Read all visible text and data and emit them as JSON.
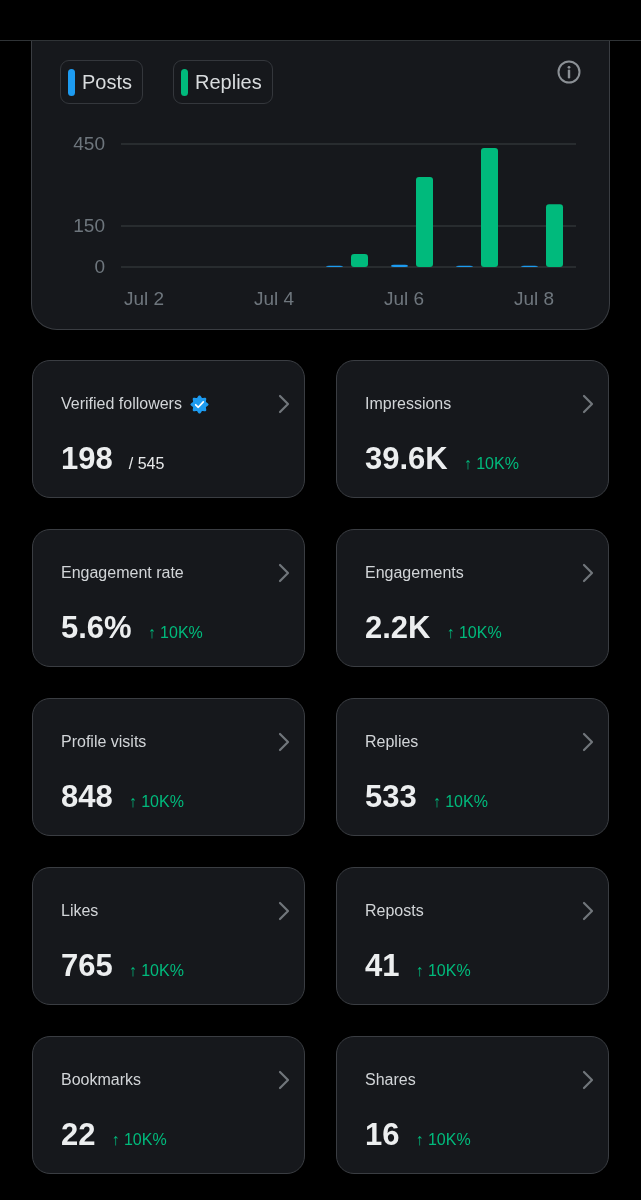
{
  "chart": {
    "chart_data": {
      "type": "bar",
      "categories": [
        "Jul 2",
        null,
        "Jul 4",
        null,
        "Jul 6",
        null,
        "Jul 8"
      ],
      "ylim": [
        0,
        450
      ],
      "yticks": [
        0,
        150,
        450
      ],
      "series": [
        {
          "name": "Posts",
          "color": "#1d9bf0",
          "values": [
            0,
            0,
            0,
            5,
            8,
            5,
            5
          ]
        },
        {
          "name": "Replies",
          "color": "#00ba7c",
          "values": [
            0,
            0,
            0,
            48,
            329,
            435,
            230
          ]
        }
      ]
    }
  },
  "cards": [
    {
      "label": "Verified followers",
      "verified": true,
      "value": "198",
      "kind": "total",
      "note": "/ 545"
    },
    {
      "label": "Impressions",
      "verified": false,
      "value": "39.6K",
      "kind": "change",
      "note": "↑ 10K%"
    },
    {
      "label": "Engagement rate",
      "verified": false,
      "value": "5.6%",
      "kind": "change",
      "note": "↑ 10K%"
    },
    {
      "label": "Engagements",
      "verified": false,
      "value": "2.2K",
      "kind": "change",
      "note": "↑ 10K%"
    },
    {
      "label": "Profile visits",
      "verified": false,
      "value": "848",
      "kind": "change",
      "note": "↑ 10K%"
    },
    {
      "label": "Replies",
      "verified": false,
      "value": "533",
      "kind": "change",
      "note": "↑ 10K%"
    },
    {
      "label": "Likes",
      "verified": false,
      "value": "765",
      "kind": "change",
      "note": "↑ 10K%"
    },
    {
      "label": "Reposts",
      "verified": false,
      "value": "41",
      "kind": "change",
      "note": "↑ 10K%"
    },
    {
      "label": "Bookmarks",
      "verified": false,
      "value": "22",
      "kind": "change",
      "note": "↑ 10K%"
    },
    {
      "label": "Shares",
      "verified": false,
      "value": "16",
      "kind": "change",
      "note": "↑ 10K%"
    }
  ]
}
